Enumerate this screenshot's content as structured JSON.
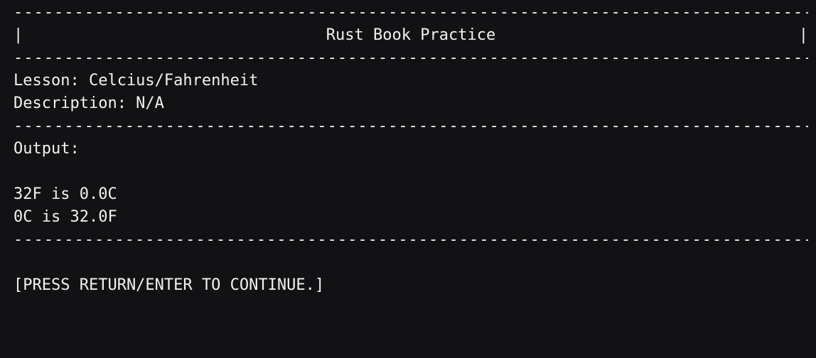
{
  "header": {
    "border_left": "|",
    "title": "Rust Book Practice",
    "border_right": "|"
  },
  "lesson": {
    "line": "Lesson: Celcius/Fahrenheit"
  },
  "description": {
    "line": "Description: N/A"
  },
  "output": {
    "label": "Output:",
    "lines": [
      "32F is 0.0C",
      "0C is 32.0F"
    ]
  },
  "prompt": {
    "text": "[PRESS RETURN/ENTER TO CONTINUE.]"
  },
  "colors": {
    "background": "#121214",
    "foreground": "#f2f2f2",
    "cursor": "#ffffff"
  }
}
